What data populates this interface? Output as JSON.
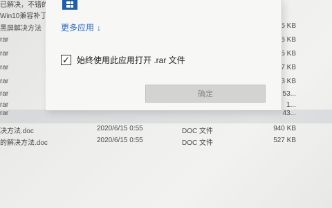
{
  "explorer": {
    "rows": [
      {
        "name": "已解决，不错的",
        "date": "",
        "type": "",
        "size": ""
      },
      {
        "name": "Win10兼容补丁",
        "date": "",
        "type": "",
        "size": ""
      },
      {
        "name": "黑屏解决方法",
        "date": "",
        "type": "",
        "size": "5 KB"
      },
      {
        "name": "rar",
        "date": "",
        "type": "",
        "size": "5 KB"
      },
      {
        "name": "rar",
        "date": "",
        "type": "",
        "size": "5 KB"
      },
      {
        "name": "rar",
        "date": "",
        "type": "",
        "size": "7 KB"
      },
      {
        "name": "rar",
        "date": "",
        "type": "",
        "size": "3 KB"
      },
      {
        "name": "rar",
        "date": "",
        "type": "",
        "size": "53..."
      },
      {
        "name": "rar",
        "date": "",
        "type": "",
        "size": "1..."
      },
      {
        "name": "rar",
        "date": "",
        "type": "",
        "size": "43..."
      },
      {
        "name": "决方法.doc",
        "date": "2020/6/15 0:55",
        "type": "DOC 文件",
        "size": "940 KB"
      },
      {
        "name": "的解决方法.doc",
        "date": "2020/6/15 0:55",
        "type": "DOC 文件",
        "size": "527 KB"
      }
    ]
  },
  "dialog": {
    "more_apps_label": "更多应用",
    "more_apps_arrow": "↓",
    "always_use_label": "始终使用此应用打开 .rar 文件",
    "always_use_checked": true,
    "checkbox_mark": "✓",
    "ok_label": "确定"
  }
}
